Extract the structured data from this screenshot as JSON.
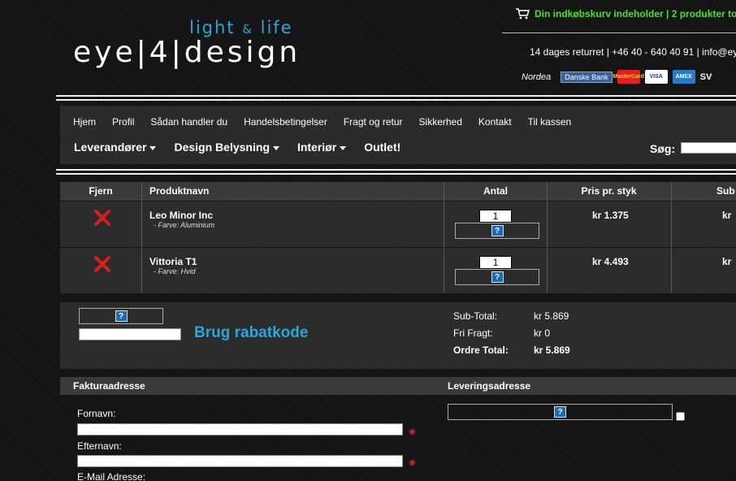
{
  "header": {
    "logo_tagline_a": "light",
    "logo_tagline_amp": "&",
    "logo_tagline_b": "life",
    "logo_main": "eye|4|design",
    "cart_text": "Din indkøbskurv indeholder | 2 produkter to",
    "contact_text": "14 dages returret | +46 40 - 640 40 91 | info@ey",
    "payment_logos": {
      "nordea": "Nordea",
      "danske": "Danske Bank",
      "mastercard": "MasterCard",
      "visa": "VISA",
      "amex": "AMEX",
      "sv": "SV"
    }
  },
  "nav": {
    "links": [
      "Hjem",
      "Profil",
      "Sådan handler du",
      "Handelsbetingelser",
      "Fragt og retur",
      "Sikkerhed",
      "Kontakt",
      "Til kassen"
    ],
    "dropdowns": [
      "Leverandører",
      "Design Belysning",
      "Interiør"
    ],
    "outlet": "Outlet!",
    "search_label": "Søg:"
  },
  "cart": {
    "headers": {
      "remove": "Fjern",
      "product": "Produktnavn",
      "qty": "Antal",
      "price": "Pris pr. styk",
      "subtotal": "Sub"
    },
    "rows": [
      {
        "name": "Leo Minor Inc",
        "option": "- Farve: Aluminium",
        "qty": "1",
        "price": "kr 1.375",
        "subtotal": "kr"
      },
      {
        "name": "Vittoria T1",
        "option": "- Farve: Hvid",
        "qty": "1",
        "price": "kr 4.493",
        "subtotal": "kr"
      }
    ],
    "update_icon": "?"
  },
  "totals": {
    "coupon_icon": "?",
    "coupon_label": "Brug rabatkode",
    "subtotal_label": "Sub-Total:",
    "subtotal_value": "kr 5.869",
    "shipping_label": "Fri Fragt:",
    "shipping_value": "kr 0",
    "total_label": "Ordre Total:",
    "total_value": "kr 5.869"
  },
  "address": {
    "billing_title": "Fakturaadresse",
    "shipping_title": "Leveringsadresse",
    "shipping_icon": "?",
    "fields": [
      "Fornavn:",
      "Efternavn:",
      "E-Mail Adresse:"
    ]
  },
  "colors": {
    "accent": "#2ba6d9",
    "cart_green": "#46e22c",
    "required_red": "#e01818"
  }
}
